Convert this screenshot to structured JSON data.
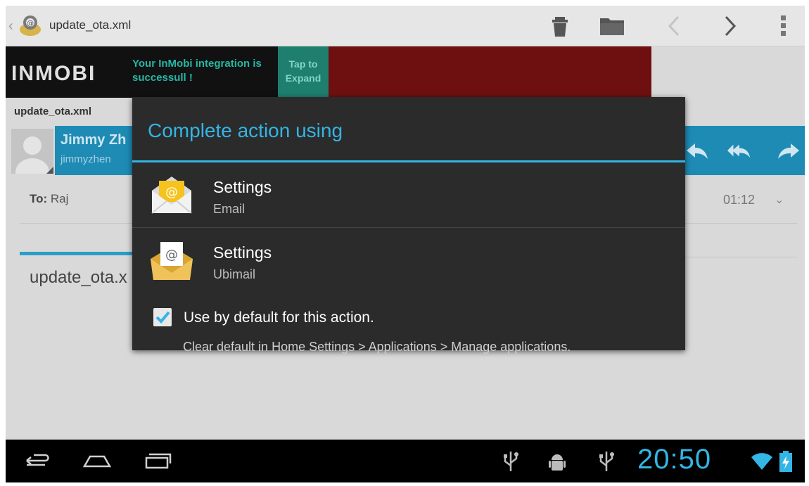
{
  "action_bar": {
    "title": "update_ota.xml",
    "back_caret": "‹"
  },
  "ad": {
    "logo": "INMOBI",
    "message": "Your InMobi integration is successull !",
    "tap_line1": "Tap to",
    "tap_line2": "Expand"
  },
  "email": {
    "subject": "update_ota.xml",
    "sender_name": "Jimmy Zh",
    "sender_email": "jimmyzhen",
    "to_label": "To:",
    "to_value": "Raj",
    "time": "01:12",
    "body_preview": "update_ota.x"
  },
  "dialog": {
    "title": "Complete action using",
    "options": [
      {
        "label": "Settings",
        "sub": "Email"
      },
      {
        "label": "Settings",
        "sub": "Ubimail"
      }
    ],
    "checkbox_label": "Use by default for this action.",
    "checkbox_checked": true,
    "hint": "Clear default in Home Settings > Applications > Manage applications."
  },
  "status": {
    "clock": "20:50"
  },
  "colors": {
    "accent": "#33b5e5",
    "sender_bar": "#1e8bb5",
    "ad_red": "#6e1010"
  }
}
